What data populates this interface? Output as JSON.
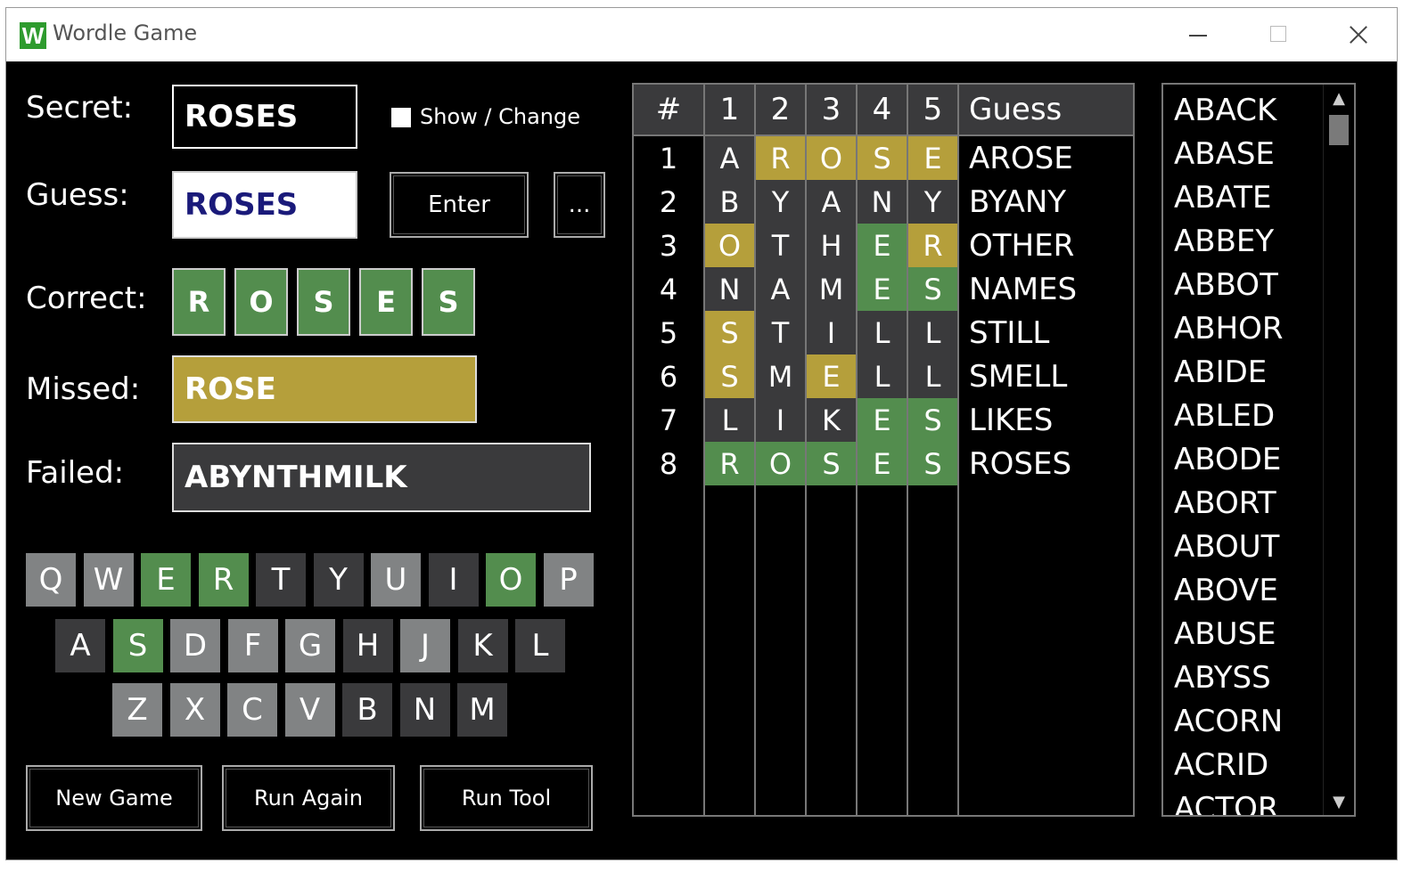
{
  "window": {
    "title": "Wordle Game",
    "icon_letter": "W"
  },
  "labels": {
    "secret": "Secret:",
    "guess": "Guess:",
    "correct": "Correct:",
    "missed": "Missed:",
    "failed": "Failed:"
  },
  "secret": {
    "value": "ROSES",
    "show_change_label": "Show / Change",
    "show_change_checked": false
  },
  "guess": {
    "value": "ROSES"
  },
  "buttons": {
    "enter": "Enter",
    "more": "...",
    "new_game": "New Game",
    "run_again": "Run Again",
    "run_tool": "Run Tool"
  },
  "correct_letters": [
    "R",
    "O",
    "S",
    "E",
    "S"
  ],
  "missed": "ROSE",
  "failed": "ABYNTHMILK",
  "keyboard": {
    "row1": [
      {
        "k": "Q",
        "s": "light"
      },
      {
        "k": "W",
        "s": "light"
      },
      {
        "k": "E",
        "s": "green"
      },
      {
        "k": "R",
        "s": "green"
      },
      {
        "k": "T",
        "s": "dark"
      },
      {
        "k": "Y",
        "s": "dark"
      },
      {
        "k": "U",
        "s": "light"
      },
      {
        "k": "I",
        "s": "dark"
      },
      {
        "k": "O",
        "s": "green"
      },
      {
        "k": "P",
        "s": "light"
      }
    ],
    "row2": [
      {
        "k": "A",
        "s": "dark"
      },
      {
        "k": "S",
        "s": "green"
      },
      {
        "k": "D",
        "s": "light"
      },
      {
        "k": "F",
        "s": "light"
      },
      {
        "k": "G",
        "s": "light"
      },
      {
        "k": "H",
        "s": "dark"
      },
      {
        "k": "J",
        "s": "light"
      },
      {
        "k": "K",
        "s": "dark"
      },
      {
        "k": "L",
        "s": "dark"
      }
    ],
    "row3": [
      {
        "k": "Z",
        "s": "light"
      },
      {
        "k": "X",
        "s": "light"
      },
      {
        "k": "C",
        "s": "light"
      },
      {
        "k": "V",
        "s": "light"
      },
      {
        "k": "B",
        "s": "dark"
      },
      {
        "k": "N",
        "s": "dark"
      },
      {
        "k": "M",
        "s": "dark"
      }
    ]
  },
  "grid": {
    "headers": [
      "#",
      "1",
      "2",
      "3",
      "4",
      "5",
      "Guess"
    ],
    "rows": [
      {
        "n": "1",
        "letters": [
          "A",
          "R",
          "O",
          "S",
          "E"
        ],
        "states": [
          "d",
          "y",
          "y",
          "y",
          "y"
        ],
        "word": "AROSE"
      },
      {
        "n": "2",
        "letters": [
          "B",
          "Y",
          "A",
          "N",
          "Y"
        ],
        "states": [
          "d",
          "d",
          "d",
          "d",
          "d"
        ],
        "word": "BYANY"
      },
      {
        "n": "3",
        "letters": [
          "O",
          "T",
          "H",
          "E",
          "R"
        ],
        "states": [
          "y",
          "d",
          "d",
          "g",
          "y"
        ],
        "word": "OTHER"
      },
      {
        "n": "4",
        "letters": [
          "N",
          "A",
          "M",
          "E",
          "S"
        ],
        "states": [
          "d",
          "d",
          "d",
          "g",
          "g"
        ],
        "word": "NAMES"
      },
      {
        "n": "5",
        "letters": [
          "S",
          "T",
          "I",
          "L",
          "L"
        ],
        "states": [
          "y",
          "d",
          "d",
          "d",
          "d"
        ],
        "word": "STILL"
      },
      {
        "n": "6",
        "letters": [
          "S",
          "M",
          "E",
          "L",
          "L"
        ],
        "states": [
          "y",
          "d",
          "y",
          "d",
          "d"
        ],
        "word": "SMELL"
      },
      {
        "n": "7",
        "letters": [
          "L",
          "I",
          "K",
          "E",
          "S"
        ],
        "states": [
          "d",
          "d",
          "d",
          "g",
          "g"
        ],
        "word": "LIKES"
      },
      {
        "n": "8",
        "letters": [
          "R",
          "O",
          "S",
          "E",
          "S"
        ],
        "states": [
          "g",
          "g",
          "g",
          "g",
          "g"
        ],
        "word": "ROSES"
      }
    ]
  },
  "word_list": [
    "ABACK",
    "ABASE",
    "ABATE",
    "ABBEY",
    "ABBOT",
    "ABHOR",
    "ABIDE",
    "ABLED",
    "ABODE",
    "ABORT",
    "ABOUT",
    "ABOVE",
    "ABUSE",
    "ABYSS",
    "ACORN",
    "ACRID",
    "ACTOR"
  ],
  "colors": {
    "green": "#538d4e",
    "yellow": "#b59f3b",
    "dark": "#3a3a3c",
    "light": "#818384"
  },
  "icons": {
    "scroll_up": "▲",
    "scroll_down": "▼"
  }
}
